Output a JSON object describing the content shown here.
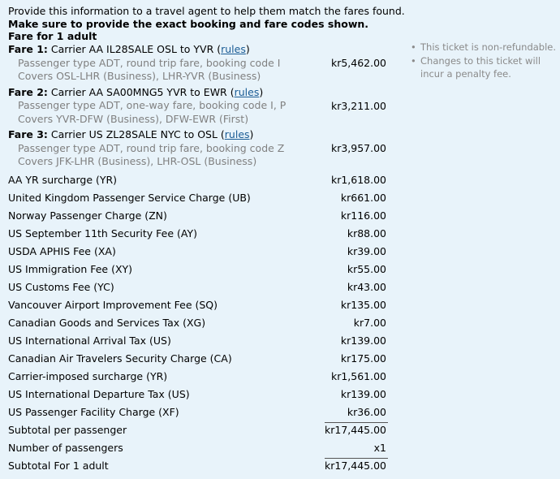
{
  "intro": {
    "line1": "Provide this information to a travel agent to help them match the fares found.",
    "line2": "Make sure to provide the exact booking and fare codes shown.",
    "line3": "Fare for 1 adult"
  },
  "fares": [
    {
      "label": "Fare 1:",
      "desc": " Carrier AA IL28SALE OSL to YVR (",
      "rules": "rules",
      "close": ")",
      "sub1": "Passenger type ADT, round trip fare, booking code I",
      "sub2": "Covers OSL-LHR (Business), LHR-YVR (Business)",
      "amount": "kr5,462.00"
    },
    {
      "label": "Fare 2:",
      "desc": " Carrier AA SA00MNG5 YVR to EWR (",
      "rules": "rules",
      "close": ")",
      "sub1": "Passenger type ADT, one-way fare, booking code I, P",
      "sub2": "Covers YVR-DFW (Business), DFW-EWR (First)",
      "amount": "kr3,211.00"
    },
    {
      "label": "Fare 3:",
      "desc": " Carrier US ZL28SALE NYC to OSL (",
      "rules": "rules",
      "close": ")",
      "sub1": "Passenger type ADT, round trip fare, booking code Z",
      "sub2": "Covers JFK-LHR (Business), LHR-OSL (Business)",
      "amount": "kr3,957.00"
    }
  ],
  "charges": [
    {
      "label": "AA YR surcharge (YR)",
      "amount": "kr1,618.00"
    },
    {
      "label": "United Kingdom Passenger Service Charge (UB)",
      "amount": "kr661.00"
    },
    {
      "label": "Norway Passenger Charge (ZN)",
      "amount": "kr116.00"
    },
    {
      "label": "US September 11th Security Fee (AY)",
      "amount": "kr88.00"
    },
    {
      "label": "USDA APHIS Fee (XA)",
      "amount": "kr39.00"
    },
    {
      "label": "US Immigration Fee (XY)",
      "amount": "kr55.00"
    },
    {
      "label": "US Customs Fee (YC)",
      "amount": "kr43.00"
    },
    {
      "label": "Vancouver Airport Improvement Fee (SQ)",
      "amount": "kr135.00"
    },
    {
      "label": "Canadian Goods and Services Tax (XG)",
      "amount": "kr7.00"
    },
    {
      "label": "US International Arrival Tax (US)",
      "amount": "kr139.00"
    },
    {
      "label": "Canadian Air Travelers Security Charge (CA)",
      "amount": "kr175.00"
    },
    {
      "label": "Carrier-imposed surcharge (YR)",
      "amount": "kr1,561.00"
    },
    {
      "label": "US International Departure Tax (US)",
      "amount": "kr139.00"
    },
    {
      "label": "US Passenger Facility Charge (XF)",
      "amount": "kr36.00"
    }
  ],
  "totals": {
    "subtotal_label": "Subtotal per passenger",
    "subtotal_amount": "kr17,445.00",
    "passengers_label": "Number of passengers",
    "passengers_value": "x1",
    "final_label": "Subtotal For 1 adult",
    "final_amount": "kr17,445.00"
  },
  "notes": {
    "bullet": "•",
    "note1": "This ticket is non-refundable.",
    "note2": "Changes to this ticket will incur a penalty fee."
  }
}
